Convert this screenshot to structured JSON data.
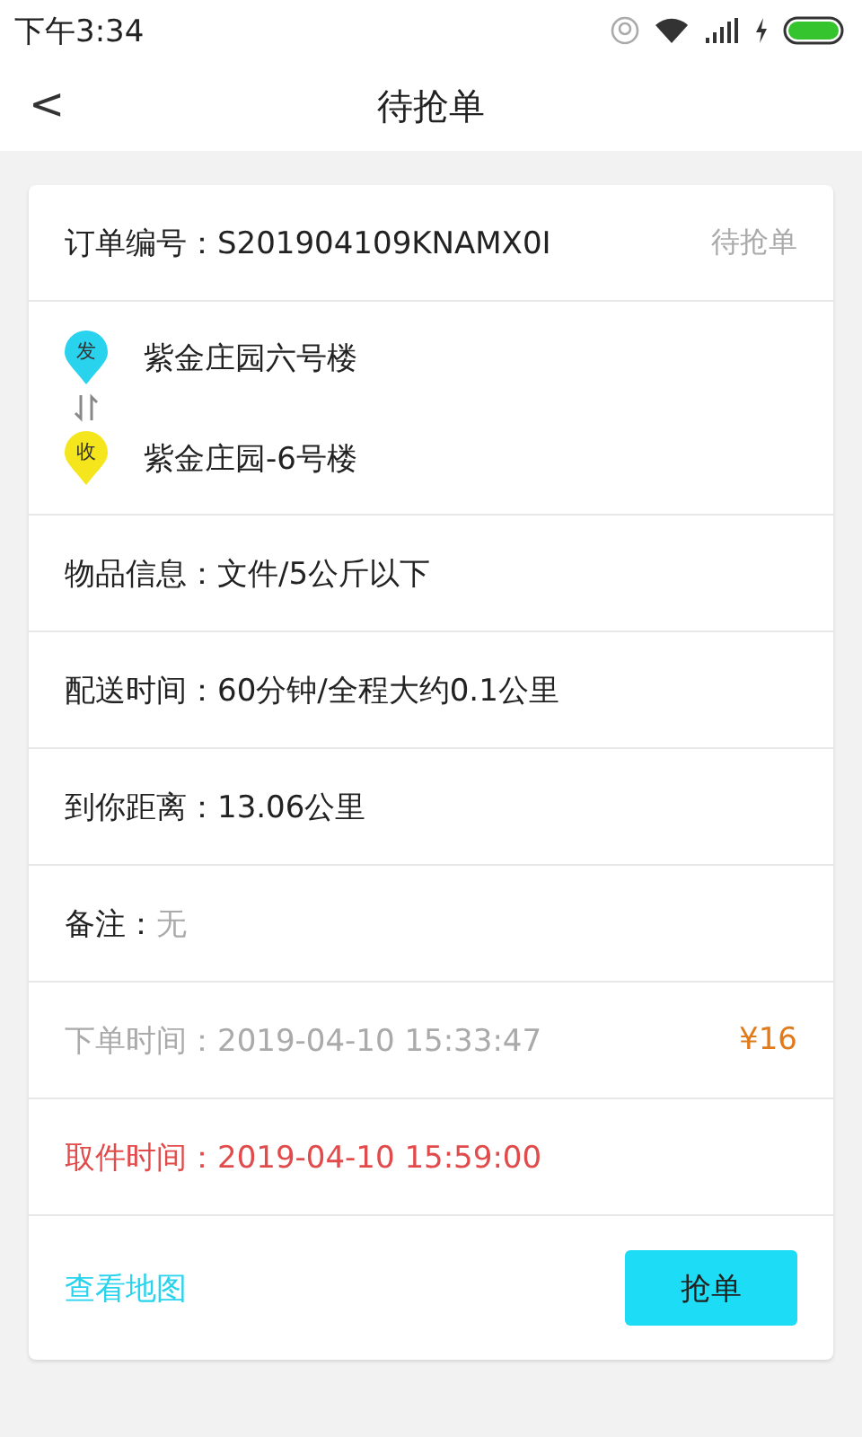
{
  "status_bar": {
    "time": "下午3:34"
  },
  "nav": {
    "back": "<",
    "title": "待抢单"
  },
  "order": {
    "number": "订单编号：S201904109KNAMX0I",
    "status": "待抢单"
  },
  "addresses": [
    {
      "badge": "发",
      "color": "#29d3ee",
      "text": "紫金庄园六号楼"
    },
    {
      "badge": "收",
      "color": "#f5e51c",
      "text": "紫金庄园-6号楼"
    }
  ],
  "rows": [
    {
      "kind": "plain",
      "text": "物品信息：文件/5公斤以下"
    },
    {
      "kind": "plain",
      "text": "配送时间：60分钟/全程大约0.1公里"
    },
    {
      "kind": "plain",
      "text": "到你距离：13.06公里"
    },
    {
      "kind": "note",
      "label": "备注：",
      "value": "无"
    },
    {
      "kind": "placed",
      "text": "下单时间：2019-04-10 15:33:47",
      "price": "¥16"
    },
    {
      "kind": "pickup",
      "text": "取件时间：2019-04-10 15:59:00"
    }
  ],
  "footer": {
    "link": "查看地图",
    "button": "抢单"
  }
}
